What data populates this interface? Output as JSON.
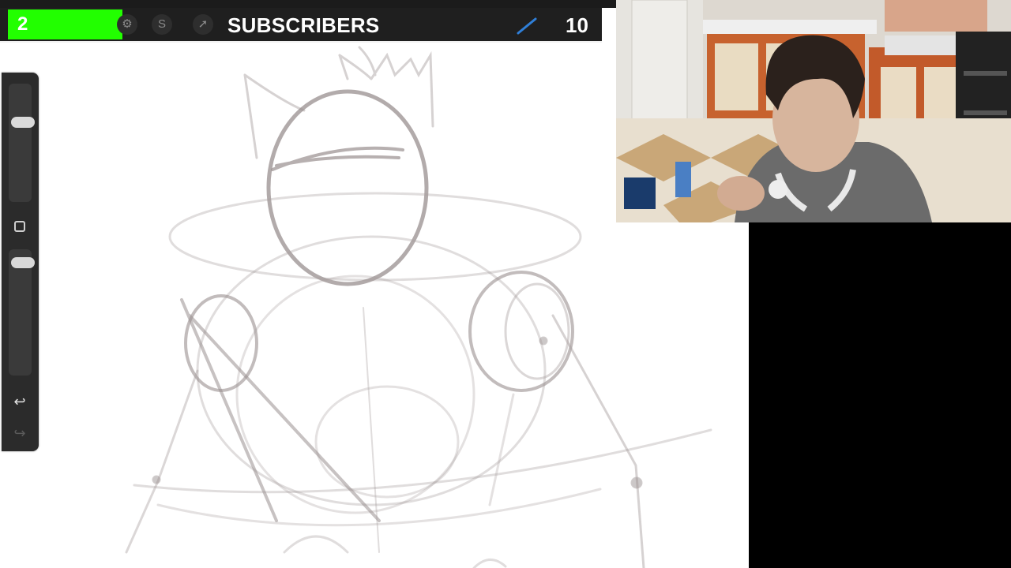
{
  "subscriber_bar": {
    "current_count": "2",
    "goal_count": "10",
    "label": "SUBSCRIBERS",
    "progress_fraction": 0.2,
    "progress_color": "#22ff00",
    "bar_color": "#1f1f1f"
  },
  "toolbar": {
    "icons": [
      "actions-icon",
      "adjustments-icon",
      "selection-icon",
      "brush-icon"
    ]
  },
  "sidebar": {
    "undo_glyph": "↩",
    "redo_glyph": "↪"
  },
  "canvas": {
    "background": "#ffffff",
    "sketch_color": "#8e8383"
  },
  "webcam": {
    "present": true
  }
}
